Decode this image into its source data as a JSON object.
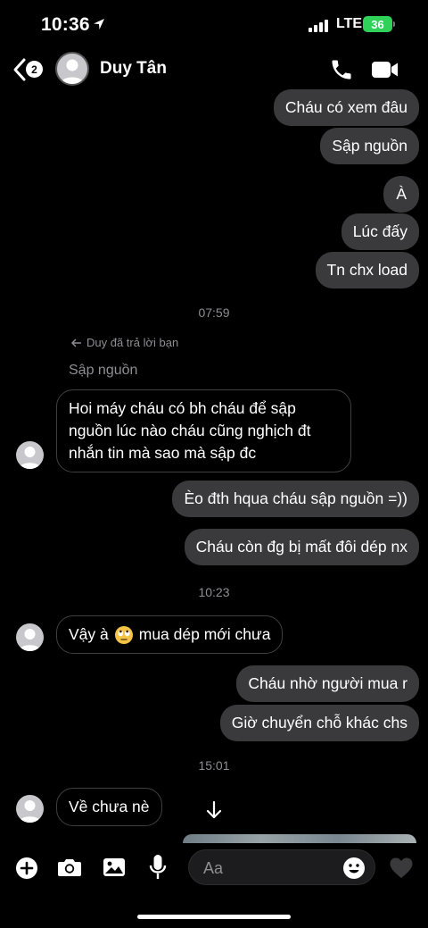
{
  "status": {
    "time": "10:36",
    "network": "LTE",
    "battery": "36"
  },
  "header": {
    "back_count": "2",
    "contact_name": "Duy Tân"
  },
  "messages": [
    {
      "side": "out",
      "text": "Cháu có xem đâu"
    },
    {
      "side": "out",
      "text": "Sập nguồn"
    },
    {
      "side": "out",
      "text": "À"
    },
    {
      "side": "out",
      "text": "Lúc đấy"
    },
    {
      "side": "out",
      "text": "Tn chx load"
    },
    {
      "side": "in",
      "text": "Hoi máy cháu có bh cháu để sập nguồn lúc nào cháu cũng nghịch đt nhắn tin mà sao mà sập đc"
    },
    {
      "side": "out",
      "text": "Èo đth hqua cháu sập nguồn =))"
    },
    {
      "side": "out",
      "text": "Cháu còn đg bị mất đôi dép nx"
    },
    {
      "side": "in",
      "text": "Vậy à"
    },
    {
      "side": "in",
      "text": "mua dép mới chưa"
    },
    {
      "side": "out",
      "text": "Cháu nhờ người mua r"
    },
    {
      "side": "out",
      "text": "Giờ chuyển chỗ khác chs"
    },
    {
      "side": "in",
      "text": "Về chưa nè"
    }
  ],
  "incoming_lines": [
    "Hoi máy cháu có bh cháu để sập",
    "nguồn lúc nào cháu cũng nghịch đt",
    "nhắn tin mà sao mà sập đc"
  ],
  "timestamps": [
    "07:59",
    "10:23",
    "15:01"
  ],
  "reply": {
    "note": "Duy đã trả lời bạn",
    "quoted": "Sập nguồn"
  },
  "composer": {
    "placeholder": "Aa"
  },
  "colors": {
    "outgoing_bubble": "#3a3a3c",
    "incoming_border": "#3f3f42",
    "battery": "#30d158"
  }
}
